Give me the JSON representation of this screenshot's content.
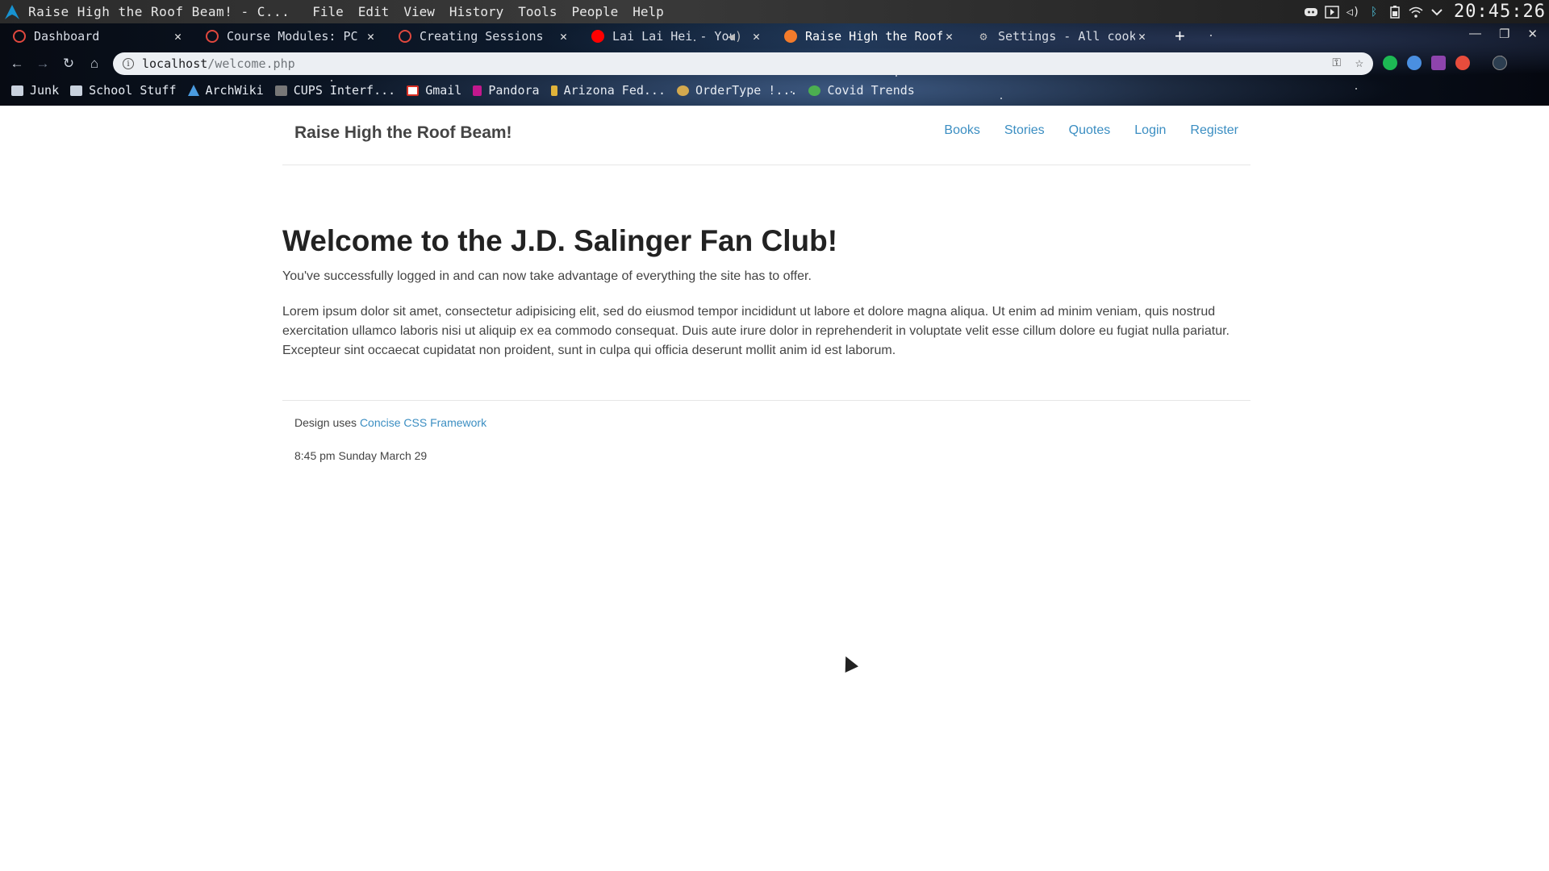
{
  "os_bar": {
    "window_title": "Raise High the Roof Beam! - C...",
    "menu": [
      "File",
      "Edit",
      "View",
      "History",
      "Tools",
      "People",
      "Help"
    ],
    "clock": "20:45:26"
  },
  "browser": {
    "tabs": [
      {
        "label": "Dashboard",
        "icon": "canvas-icon",
        "active": false
      },
      {
        "label": "Course Modules: PC",
        "icon": "canvas-icon",
        "active": false
      },
      {
        "label": "Creating Sessions",
        "icon": "canvas-icon",
        "active": false
      },
      {
        "label": "Lai Lai Hei - You",
        "icon": "youtube-icon",
        "active": false
      },
      {
        "label": "Raise High the Roof",
        "icon": "site-icon",
        "active": true
      },
      {
        "label": "Settings - All cook",
        "icon": "gear-icon",
        "active": false
      }
    ],
    "new_tab_symbol": "+",
    "url_host": "localhost",
    "url_path": "/welcome.php",
    "bookmarks": [
      {
        "label": "Junk",
        "icon": "folder-icon"
      },
      {
        "label": "School Stuff",
        "icon": "folder-icon"
      },
      {
        "label": "ArchWiki",
        "icon": "arch-icon"
      },
      {
        "label": "CUPS Interf...",
        "icon": "cups-icon"
      },
      {
        "label": "Gmail",
        "icon": "gmail-icon"
      },
      {
        "label": "Pandora",
        "icon": "pandora-icon"
      },
      {
        "label": "Arizona Fed...",
        "icon": "bank-icon"
      },
      {
        "label": "OrderType !...",
        "icon": "ordertype-icon"
      },
      {
        "label": "Covid Trends",
        "icon": "virus-icon"
      }
    ]
  },
  "site": {
    "title": "Raise High the Roof Beam!",
    "nav": [
      "Books",
      "Stories",
      "Quotes",
      "Login",
      "Register"
    ],
    "heading": "Welcome to the J.D. Salinger Fan Club!",
    "lead": "You've successfully logged in and can now take advantage of everything the site has to offer.",
    "body": "Lorem ipsum dolor sit amet, consectetur adipisicing elit, sed do eiusmod tempor incididunt ut labore et dolore magna aliqua. Ut enim ad minim veniam, quis nostrud exercitation ullamco laboris nisi ut aliquip ex ea commodo consequat. Duis aute irure dolor in reprehenderit in voluptate velit esse cillum dolore eu fugiat nulla pariatur. Excepteur sint occaecat cupidatat non proident, sunt in culpa qui officia deserunt mollit anim id est laborum.",
    "footer": {
      "credits_prefix": "Design uses",
      "credits_link": "Concise CSS Framework",
      "date": "8:45 pm Sunday March 29"
    }
  },
  "colors": {
    "link": "#3b8ec2",
    "heading": "#222222",
    "text": "#444444"
  }
}
